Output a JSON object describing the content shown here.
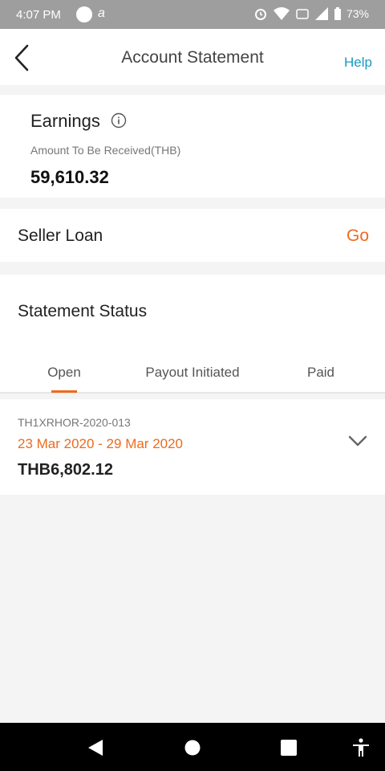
{
  "status_bar": {
    "time": "4:07 PM",
    "app_mark": "a",
    "battery": "73%"
  },
  "header": {
    "title": "Account Statement",
    "help": "Help"
  },
  "earnings": {
    "label": "Earnings",
    "subtitle": "Amount To Be Received(THB)",
    "amount": "59,610.32"
  },
  "seller_loan": {
    "label": "Seller Loan",
    "action": "Go"
  },
  "statement_status": {
    "heading": "Statement Status",
    "tabs": [
      {
        "label": "Open",
        "active": true
      },
      {
        "label": "Payout Initiated",
        "active": false
      },
      {
        "label": "Paid",
        "active": false
      }
    ]
  },
  "statements": [
    {
      "reference": "TH1XRHOR-2020-013",
      "period": "23 Mar 2020 - 29 Mar 2020",
      "amount": "THB6,802.12"
    }
  ],
  "colors": {
    "accent": "#ee6a1d",
    "link": "#1a9ac2",
    "status_bar": "#9e9e9e",
    "background": "#f4f4f4"
  },
  "icons": [
    "back-arrow-icon",
    "info-icon",
    "chevron-down-icon",
    "alarm-icon",
    "wifi-icon",
    "signal-icon",
    "battery-icon",
    "nav-back-icon",
    "nav-home-icon",
    "nav-recents-icon",
    "accessibility-icon"
  ]
}
